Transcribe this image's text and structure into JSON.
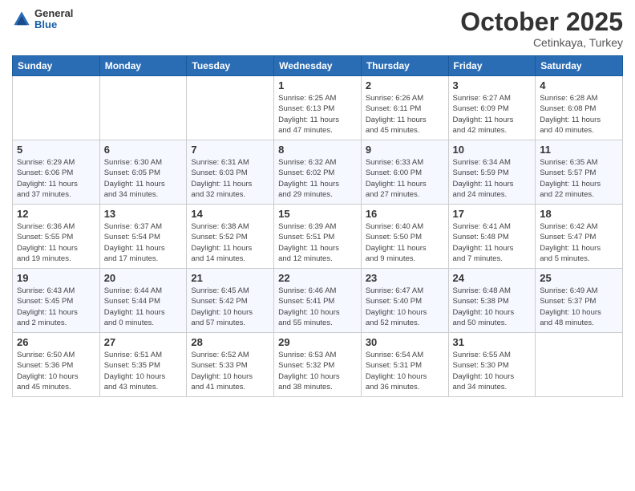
{
  "header": {
    "logo": {
      "general": "General",
      "blue": "Blue"
    },
    "title": "October 2025",
    "location": "Cetinkaya, Turkey"
  },
  "weekdays": [
    "Sunday",
    "Monday",
    "Tuesday",
    "Wednesday",
    "Thursday",
    "Friday",
    "Saturday"
  ],
  "weeks": [
    [
      {
        "day": "",
        "info": ""
      },
      {
        "day": "",
        "info": ""
      },
      {
        "day": "",
        "info": ""
      },
      {
        "day": "1",
        "info": "Sunrise: 6:25 AM\nSunset: 6:13 PM\nDaylight: 11 hours\nand 47 minutes."
      },
      {
        "day": "2",
        "info": "Sunrise: 6:26 AM\nSunset: 6:11 PM\nDaylight: 11 hours\nand 45 minutes."
      },
      {
        "day": "3",
        "info": "Sunrise: 6:27 AM\nSunset: 6:09 PM\nDaylight: 11 hours\nand 42 minutes."
      },
      {
        "day": "4",
        "info": "Sunrise: 6:28 AM\nSunset: 6:08 PM\nDaylight: 11 hours\nand 40 minutes."
      }
    ],
    [
      {
        "day": "5",
        "info": "Sunrise: 6:29 AM\nSunset: 6:06 PM\nDaylight: 11 hours\nand 37 minutes."
      },
      {
        "day": "6",
        "info": "Sunrise: 6:30 AM\nSunset: 6:05 PM\nDaylight: 11 hours\nand 34 minutes."
      },
      {
        "day": "7",
        "info": "Sunrise: 6:31 AM\nSunset: 6:03 PM\nDaylight: 11 hours\nand 32 minutes."
      },
      {
        "day": "8",
        "info": "Sunrise: 6:32 AM\nSunset: 6:02 PM\nDaylight: 11 hours\nand 29 minutes."
      },
      {
        "day": "9",
        "info": "Sunrise: 6:33 AM\nSunset: 6:00 PM\nDaylight: 11 hours\nand 27 minutes."
      },
      {
        "day": "10",
        "info": "Sunrise: 6:34 AM\nSunset: 5:59 PM\nDaylight: 11 hours\nand 24 minutes."
      },
      {
        "day": "11",
        "info": "Sunrise: 6:35 AM\nSunset: 5:57 PM\nDaylight: 11 hours\nand 22 minutes."
      }
    ],
    [
      {
        "day": "12",
        "info": "Sunrise: 6:36 AM\nSunset: 5:55 PM\nDaylight: 11 hours\nand 19 minutes."
      },
      {
        "day": "13",
        "info": "Sunrise: 6:37 AM\nSunset: 5:54 PM\nDaylight: 11 hours\nand 17 minutes."
      },
      {
        "day": "14",
        "info": "Sunrise: 6:38 AM\nSunset: 5:52 PM\nDaylight: 11 hours\nand 14 minutes."
      },
      {
        "day": "15",
        "info": "Sunrise: 6:39 AM\nSunset: 5:51 PM\nDaylight: 11 hours\nand 12 minutes."
      },
      {
        "day": "16",
        "info": "Sunrise: 6:40 AM\nSunset: 5:50 PM\nDaylight: 11 hours\nand 9 minutes."
      },
      {
        "day": "17",
        "info": "Sunrise: 6:41 AM\nSunset: 5:48 PM\nDaylight: 11 hours\nand 7 minutes."
      },
      {
        "day": "18",
        "info": "Sunrise: 6:42 AM\nSunset: 5:47 PM\nDaylight: 11 hours\nand 5 minutes."
      }
    ],
    [
      {
        "day": "19",
        "info": "Sunrise: 6:43 AM\nSunset: 5:45 PM\nDaylight: 11 hours\nand 2 minutes."
      },
      {
        "day": "20",
        "info": "Sunrise: 6:44 AM\nSunset: 5:44 PM\nDaylight: 11 hours\nand 0 minutes."
      },
      {
        "day": "21",
        "info": "Sunrise: 6:45 AM\nSunset: 5:42 PM\nDaylight: 10 hours\nand 57 minutes."
      },
      {
        "day": "22",
        "info": "Sunrise: 6:46 AM\nSunset: 5:41 PM\nDaylight: 10 hours\nand 55 minutes."
      },
      {
        "day": "23",
        "info": "Sunrise: 6:47 AM\nSunset: 5:40 PM\nDaylight: 10 hours\nand 52 minutes."
      },
      {
        "day": "24",
        "info": "Sunrise: 6:48 AM\nSunset: 5:38 PM\nDaylight: 10 hours\nand 50 minutes."
      },
      {
        "day": "25",
        "info": "Sunrise: 6:49 AM\nSunset: 5:37 PM\nDaylight: 10 hours\nand 48 minutes."
      }
    ],
    [
      {
        "day": "26",
        "info": "Sunrise: 6:50 AM\nSunset: 5:36 PM\nDaylight: 10 hours\nand 45 minutes."
      },
      {
        "day": "27",
        "info": "Sunrise: 6:51 AM\nSunset: 5:35 PM\nDaylight: 10 hours\nand 43 minutes."
      },
      {
        "day": "28",
        "info": "Sunrise: 6:52 AM\nSunset: 5:33 PM\nDaylight: 10 hours\nand 41 minutes."
      },
      {
        "day": "29",
        "info": "Sunrise: 6:53 AM\nSunset: 5:32 PM\nDaylight: 10 hours\nand 38 minutes."
      },
      {
        "day": "30",
        "info": "Sunrise: 6:54 AM\nSunset: 5:31 PM\nDaylight: 10 hours\nand 36 minutes."
      },
      {
        "day": "31",
        "info": "Sunrise: 6:55 AM\nSunset: 5:30 PM\nDaylight: 10 hours\nand 34 minutes."
      },
      {
        "day": "",
        "info": ""
      }
    ]
  ]
}
